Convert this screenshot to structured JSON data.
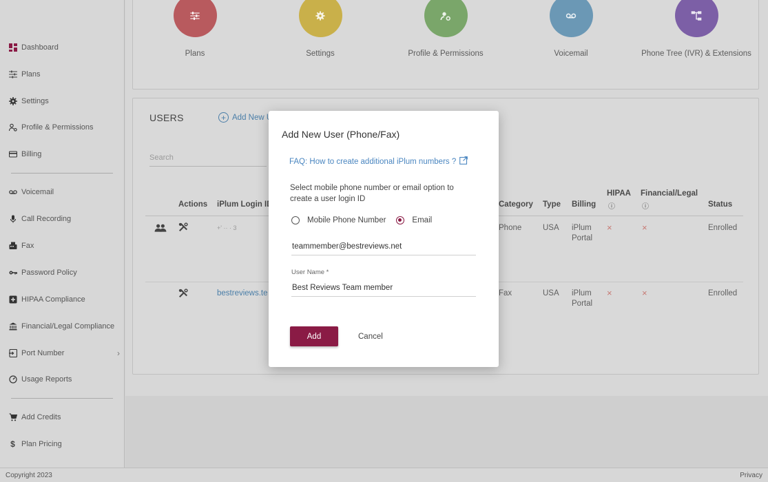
{
  "sidebar": {
    "items": [
      {
        "label": "Dashboard",
        "icon": "dashboard-icon"
      },
      {
        "label": "Plans",
        "icon": "sliders-icon"
      },
      {
        "label": "Settings",
        "icon": "gear-icon"
      },
      {
        "label": "Profile & Permissions",
        "icon": "user-permissions-icon"
      },
      {
        "label": "Billing",
        "icon": "credit-card-icon"
      },
      {
        "label": "Voicemail",
        "icon": "voicemail-icon"
      },
      {
        "label": "Call Recording",
        "icon": "microphone-icon"
      },
      {
        "label": "Fax",
        "icon": "fax-icon"
      },
      {
        "label": "Password Policy",
        "icon": "key-icon"
      },
      {
        "label": "HIPAA Compliance",
        "icon": "medical-plus-icon"
      },
      {
        "label": "Financial/Legal Compliance",
        "icon": "bank-icon"
      },
      {
        "label": "Port Number",
        "icon": "port-in-icon"
      },
      {
        "label": "Usage Reports",
        "icon": "gauge-icon"
      },
      {
        "label": "Add Credits",
        "icon": "cart-icon"
      },
      {
        "label": "Plan Pricing",
        "icon": "dollar-icon"
      }
    ]
  },
  "tiles": [
    {
      "label": "Plans",
      "color": "#b85a5e",
      "icon": "sliders-icon"
    },
    {
      "label": "Settings",
      "color": "#c9b04a",
      "icon": "gear-icon"
    },
    {
      "label": "Profile & Permissions",
      "color": "#7aa66a",
      "icon": "user-permissions-icon"
    },
    {
      "label": "Voicemail",
      "color": "#6b98b5",
      "icon": "voicemail-icon"
    },
    {
      "label": "Phone Tree (IVR) & Extensions",
      "color": "#7c5fa6",
      "icon": "phone-tree-icon"
    }
  ],
  "users": {
    "title": "USERS",
    "add_new_label": "Add New U",
    "search_placeholder": "Search",
    "columns": {
      "actions": "Actions",
      "login_id": "iPlum Login ID",
      "category": "Category",
      "type": "Type",
      "billing": "Billing",
      "hipaa": "HIPAA",
      "financial": "Financial/Legal",
      "status": "Status"
    },
    "rows": [
      {
        "login_id": "+' ·· ·   3",
        "category": "Phone",
        "type": "USA",
        "billing_line1": "iPlum",
        "billing_line2": "Portal",
        "hipaa": "×",
        "financial": "×",
        "status": "Enrolled"
      },
      {
        "login_id": "bestreviews.te",
        "category": "Fax",
        "type": "USA",
        "billing_line1": "iPlum",
        "billing_line2": "Portal",
        "hipaa": "×",
        "financial": "×",
        "status": "Enrolled"
      }
    ]
  },
  "modal": {
    "title": "Add New User (Phone/Fax)",
    "faq_link": "FAQ: How to create additional iPlum numbers ?",
    "instruction": "Select mobile phone number or email option to create a user login ID",
    "option_phone": "Mobile Phone Number",
    "option_email": "Email",
    "selected_option": "Email",
    "email_value": "teammember@bestreviews.net",
    "username_label": "User Name *",
    "username_value": "Best Reviews Team member",
    "add_button": "Add",
    "cancel_button": "Cancel",
    "accent_color": "#8a1b45",
    "link_color": "#4a86c0"
  },
  "footer": {
    "copyright": "Copyright 2023",
    "privacy": "Privacy"
  }
}
